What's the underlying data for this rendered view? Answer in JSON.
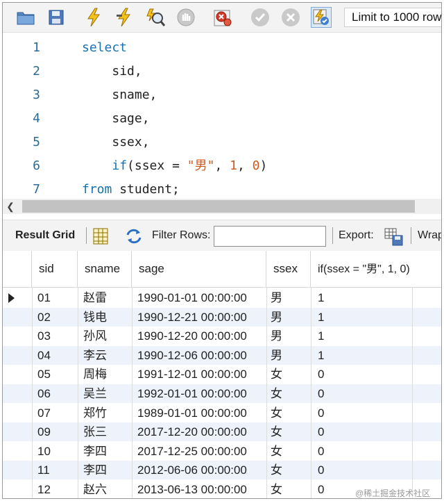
{
  "toolbar": {
    "buttons": [
      "open-folder-icon",
      "save-icon",
      "execute-icon",
      "execute-current-icon",
      "explain-icon",
      "stop-icon",
      "toggle-error-icon",
      "commit-icon",
      "rollback-icon",
      "autocommit-icon"
    ],
    "limit_label": "Limit to 1000 rows"
  },
  "editor": {
    "lines": [
      {
        "num": "1",
        "indent": "",
        "tokens": [
          {
            "t": "select",
            "c": "kw"
          }
        ]
      },
      {
        "num": "2",
        "indent": "    ",
        "tokens": [
          {
            "t": "sid,",
            "c": ""
          }
        ]
      },
      {
        "num": "3",
        "indent": "    ",
        "tokens": [
          {
            "t": "sname,",
            "c": ""
          }
        ]
      },
      {
        "num": "4",
        "indent": "    ",
        "tokens": [
          {
            "t": "sage,",
            "c": ""
          }
        ]
      },
      {
        "num": "5",
        "indent": "    ",
        "tokens": [
          {
            "t": "ssex,",
            "c": ""
          }
        ]
      },
      {
        "num": "6",
        "indent": "    ",
        "tokens": [
          {
            "t": "if",
            "c": "kw"
          },
          {
            "t": "(ssex = ",
            "c": ""
          },
          {
            "t": "\"男\"",
            "c": "str"
          },
          {
            "t": ", ",
            "c": ""
          },
          {
            "t": "1",
            "c": "num"
          },
          {
            "t": ", ",
            "c": ""
          },
          {
            "t": "0",
            "c": "num"
          },
          {
            "t": ")",
            "c": ""
          }
        ]
      },
      {
        "num": "7",
        "indent": "",
        "tokens": [
          {
            "t": "from",
            "c": "kw"
          },
          {
            "t": " student;",
            "c": ""
          }
        ]
      }
    ]
  },
  "result_toolbar": {
    "result_grid_label": "Result Grid",
    "filter_label": "Filter Rows:",
    "filter_value": "",
    "export_label": "Export:",
    "wrap_label": "Wrap"
  },
  "grid": {
    "columns": [
      "sid",
      "sname",
      "sage",
      "ssex",
      "if(ssex = \"男\", 1, 0)"
    ],
    "rows": [
      [
        "01",
        "赵雷",
        "1990-01-01 00:00:00",
        "男",
        "1"
      ],
      [
        "02",
        "钱电",
        "1990-12-21 00:00:00",
        "男",
        "1"
      ],
      [
        "03",
        "孙风",
        "1990-12-20 00:00:00",
        "男",
        "1"
      ],
      [
        "04",
        "李云",
        "1990-12-06 00:00:00",
        "男",
        "1"
      ],
      [
        "05",
        "周梅",
        "1991-12-01 00:00:00",
        "女",
        "0"
      ],
      [
        "06",
        "吴兰",
        "1992-01-01 00:00:00",
        "女",
        "0"
      ],
      [
        "07",
        "郑竹",
        "1989-01-01 00:00:00",
        "女",
        "0"
      ],
      [
        "09",
        "张三",
        "2017-12-20 00:00:00",
        "女",
        "0"
      ],
      [
        "10",
        "李四",
        "2017-12-25 00:00:00",
        "女",
        "0"
      ],
      [
        "11",
        "李四",
        "2012-06-06 00:00:00",
        "女",
        "0"
      ],
      [
        "12",
        "赵六",
        "2013-06-13 00:00:00",
        "女",
        "0"
      ]
    ]
  },
  "watermark": "@稀土掘金技术社区"
}
